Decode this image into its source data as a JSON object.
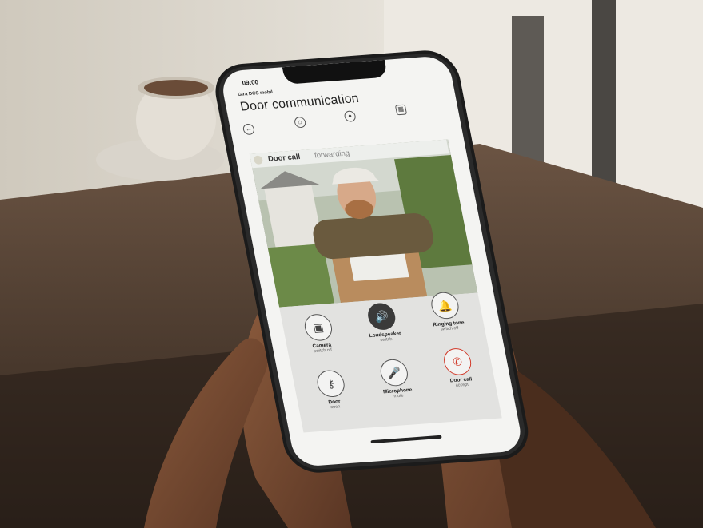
{
  "status": {
    "time": "09:00"
  },
  "app": {
    "name": "Gira DCS mobil",
    "title": "Door communication"
  },
  "banner": {
    "strong": "Door call",
    "rest": "forwarding"
  },
  "controls": [
    {
      "label": "Camera",
      "sub": "switch off",
      "icon": "camera-icon"
    },
    {
      "label": "Loudspeaker",
      "sub": "switch",
      "icon": "speaker-icon"
    },
    {
      "label": "Ringing tone",
      "sub": "switch off",
      "icon": "bell-icon"
    },
    {
      "label": "Door",
      "sub": "open",
      "icon": "key-icon"
    },
    {
      "label": "Microphone",
      "sub": "mute",
      "icon": "microphone-icon"
    },
    {
      "label": "Door call",
      "sub": "accept",
      "icon": "phone-icon"
    }
  ],
  "colors": {
    "accent_red": "#d23a2a",
    "speaker_active": "#3a3a3a"
  }
}
